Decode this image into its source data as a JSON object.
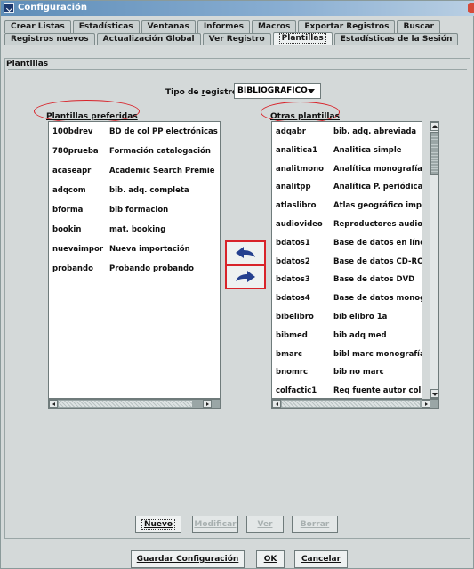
{
  "window": {
    "title": "Configuración"
  },
  "tabs_row1": [
    "Crear Listas",
    "Estadísticas",
    "Ventanas",
    "Informes",
    "Macros",
    "Exportar Registros",
    "Buscar"
  ],
  "tabs_row2": [
    "Registros nuevos",
    "Actualización Global",
    "Ver Registro",
    "Plantillas",
    "Estadísticas de la Sesión"
  ],
  "active_tab": "Plantillas",
  "panel": {
    "title": "Plantillas"
  },
  "tipo": {
    "label_pre": "Tipo de ",
    "label_hot": "r",
    "label_post": "egistro",
    "value": "BIBLIOGRAFICO"
  },
  "preferidas": {
    "label": "Plantillas preferidas",
    "rows": [
      [
        "100bdrev",
        "BD de col PP electrónicas"
      ],
      [
        "780prueba",
        "Formación catalogación"
      ],
      [
        "acaseapr",
        "Academic Search Premie"
      ],
      [
        "adqcom",
        "bib. adq. completa"
      ],
      [
        "bforma",
        "bib formacion"
      ],
      [
        "bookin",
        "mat. booking"
      ],
      [
        "nuevaimpor",
        "Nueva importación"
      ],
      [
        "probando",
        "Probando probando"
      ]
    ]
  },
  "otras": {
    "label": "Otras plantillas",
    "rows": [
      [
        "adqabr",
        "bib. adq. abreviada"
      ],
      [
        "analitica1",
        "Analitica simple"
      ],
      [
        "analitmono",
        "Analítica monografía"
      ],
      [
        "analitpp",
        "Analítica P. periódica"
      ],
      [
        "atlaslibro",
        "Atlas geográfico impre"
      ],
      [
        "audiovideo",
        "Reproductores audio/v"
      ],
      [
        "bdatos1",
        "Base de datos en línea"
      ],
      [
        "bdatos2",
        "Base de datos CD-ROM"
      ],
      [
        "bdatos3",
        "Base de datos DVD"
      ],
      [
        "bdatos4",
        "Base de datos monogr"
      ],
      [
        "bibelibro",
        "bib elibro 1a"
      ],
      [
        "bibmed",
        "bib adq med"
      ],
      [
        "bmarc",
        "bibl marc monografías"
      ],
      [
        "bnomrc",
        "bib no marc"
      ],
      [
        "colfactic1",
        "Req fuente autor col fa"
      ]
    ]
  },
  "buttons": {
    "nuevo": "Nuevo",
    "modificar": "Modificar",
    "ver": "Ver",
    "borrar": "Borrar"
  },
  "footer": {
    "guardar": "Guardar Configuración",
    "ok": "OK",
    "cancelar": "Cancelar"
  },
  "colors": {
    "arrow": "#25408f",
    "highlight": "#d8232a"
  }
}
